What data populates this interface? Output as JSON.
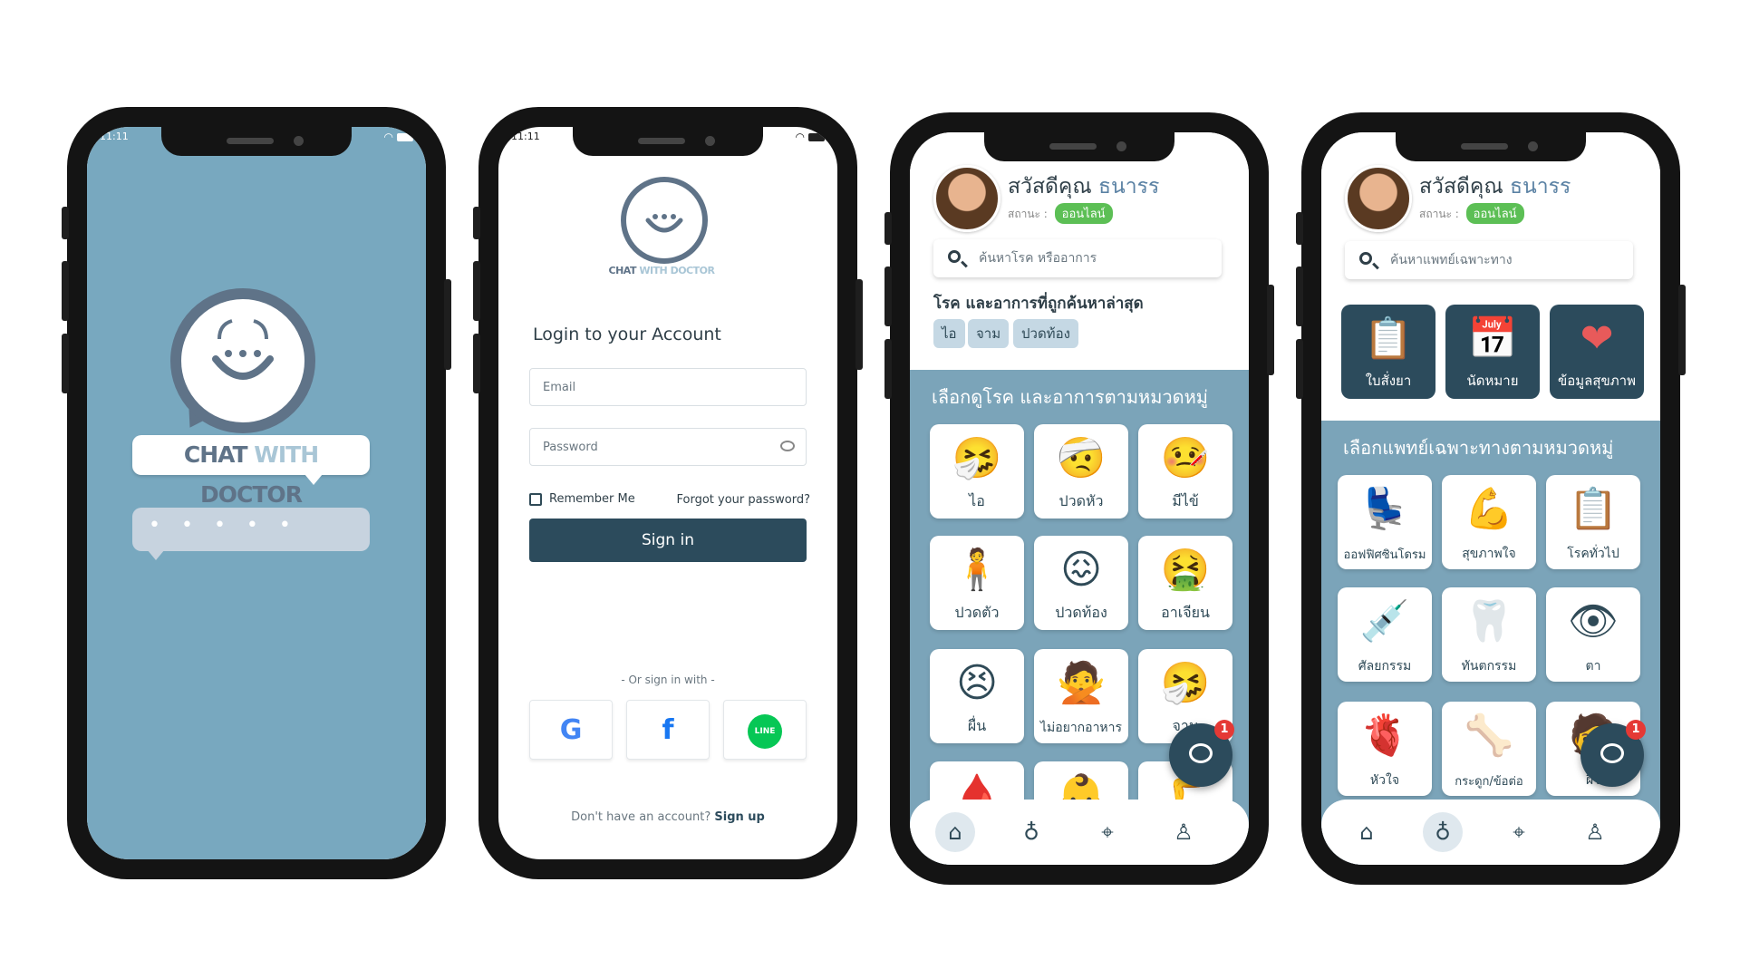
{
  "status_time": "11:11",
  "splash": {
    "title_part1": "CHAT",
    "title_part2": "WITH",
    "title_part3": "DOCTOR",
    "dots": "• • • • •"
  },
  "login": {
    "logo_part1": "CHAT",
    "logo_part2": "WITH DOCTOR",
    "heading": "Login to your Account",
    "email_placeholder": "Email",
    "password_placeholder": "Password",
    "remember": "Remember Me",
    "forgot": "Forgot your password?",
    "signin": "Sign in",
    "or_sign_in": "- Or sign in with -",
    "social": [
      {
        "name": "google",
        "glyph": "G",
        "color": "#4285F4"
      },
      {
        "name": "facebook",
        "glyph": "f",
        "color": "#1877F2"
      },
      {
        "name": "line",
        "glyph": "LINE",
        "color": "#06C755"
      }
    ],
    "no_account": "Don't have an account?",
    "signup": "Sign up"
  },
  "home": {
    "greeting": "สวัสดีคุณ",
    "name": "ธนารร",
    "status_label": "สถานะ :",
    "status_value": "ออนไลน์",
    "search_placeholder": "ค้นหาโรค หรืออาการ",
    "recent_title": "โรค และอาการที่ถูกค้นหาล่าสุด",
    "chips": [
      "ไอ",
      "จาม",
      "ปวดท้อง"
    ],
    "category_title": "เลือกดูโรค และอาการตามหมวดหมู่",
    "tiles": [
      {
        "label": "ไอ",
        "icon": "🤧"
      },
      {
        "label": "ปวดหัว",
        "icon": "🤕"
      },
      {
        "label": "มีไข้",
        "icon": "🤒"
      },
      {
        "label": "ปวดตัว",
        "icon": "🧍"
      },
      {
        "label": "ปวดท้อง",
        "icon": "😖"
      },
      {
        "label": "อาเจียน",
        "icon": "🤮"
      },
      {
        "label": "ผื่น",
        "icon": "😣"
      },
      {
        "label": "ไม่อยากอาหาร",
        "icon": "🙅"
      },
      {
        "label": "จาม",
        "icon": "🤧"
      },
      {
        "label": "",
        "icon": "🩸"
      },
      {
        "label": "",
        "icon": "👶"
      },
      {
        "label": "",
        "icon": "🦵"
      }
    ],
    "fab_badge": "1"
  },
  "doctor": {
    "greeting": "สวัสดีคุณ",
    "name": "ธนารร",
    "status_label": "สถานะ :",
    "status_value": "ออนไลน์",
    "search_placeholder": "ค้นหาแพทย์เฉพาะทาง",
    "quick": [
      {
        "label": "ใบสั่งยา",
        "icon": "📋"
      },
      {
        "label": "นัดหมาย",
        "icon": "📅"
      },
      {
        "label": "ข้อมูลสุขภาพ",
        "icon": "❤"
      }
    ],
    "category_title": "เลือกแพทย์เฉพาะทางตามหมวดหมู่",
    "tiles": [
      {
        "label": "ออฟฟิศซินโดรม",
        "icon": "💺"
      },
      {
        "label": "สุขภาพใจ",
        "icon": "💪"
      },
      {
        "label": "โรคทั่วไป",
        "icon": "📋"
      },
      {
        "label": "ศัลยกรรม",
        "icon": "💉"
      },
      {
        "label": "ทันตกรรม",
        "icon": "🦷"
      },
      {
        "label": "ตา",
        "icon": "👁"
      },
      {
        "label": "หัวใจ",
        "icon": "🫀"
      },
      {
        "label": "กระดูก/ข้อต่อ",
        "icon": "🦴"
      },
      {
        "label": "ผิว",
        "icon": "🧑"
      }
    ],
    "fab_badge": "1"
  },
  "nav_icons": [
    "home-icon",
    "stethoscope-icon",
    "map-pin-icon",
    "profile-icon"
  ]
}
